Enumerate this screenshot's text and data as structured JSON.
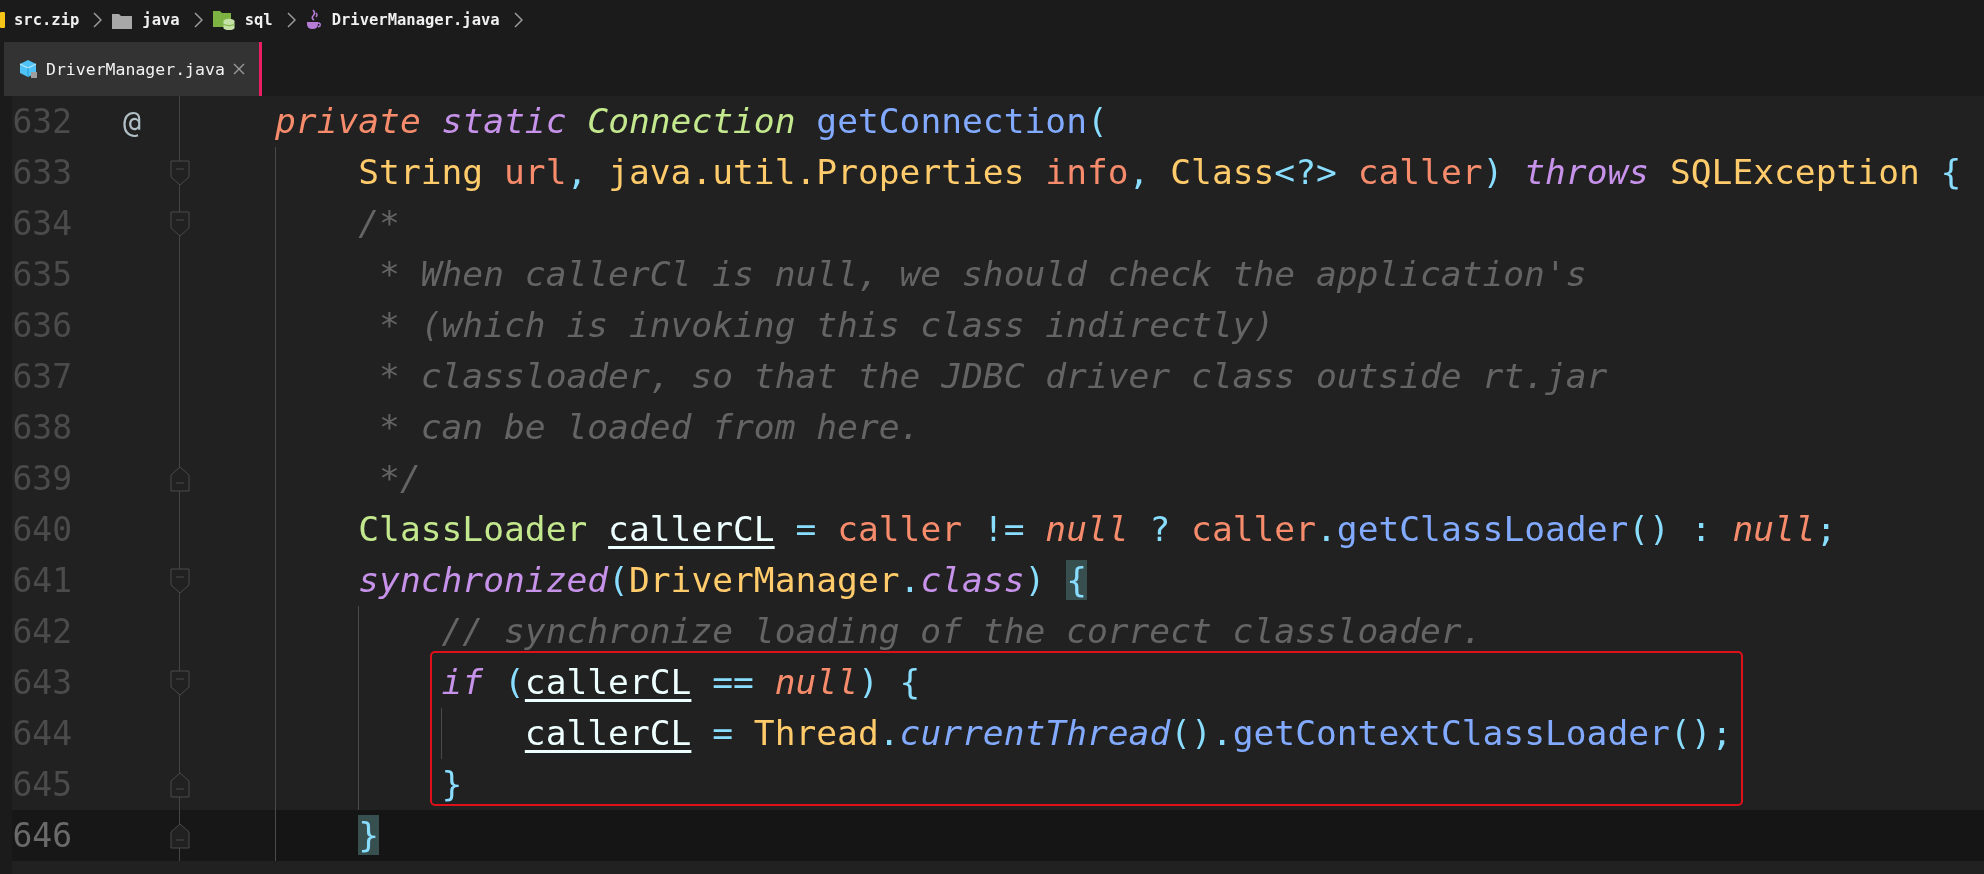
{
  "breadcrumb": [
    {
      "label": "src.zip",
      "kind": "archive"
    },
    {
      "label": "java",
      "kind": "folder"
    },
    {
      "label": "sql",
      "kind": "package"
    },
    {
      "label": "DriverManager.java",
      "kind": "java"
    }
  ],
  "tabs": [
    {
      "label": "DriverManager.java",
      "selected": true
    }
  ],
  "editor": {
    "lines": [
      {
        "number": "632",
        "marker": "@",
        "fold_start": false,
        "fold_end": false,
        "boxed": false,
        "current": false,
        "tokens": [
          {
            "text": "private",
            "kind": "modifier"
          },
          {
            "text": " static",
            "kind": "keyword"
          },
          {
            "text": " Connection",
            "kind": "classname-italic"
          },
          {
            "text": " getConnection",
            "kind": "function"
          },
          {
            "text": "(",
            "kind": "punct"
          }
        ]
      },
      {
        "number": "633",
        "fold_start": true,
        "fold_end": false,
        "boxed": false,
        "current": false,
        "tokens": [
          {
            "text": "    String",
            "kind": "type"
          },
          {
            "text": " url",
            "kind": "param"
          },
          {
            "text": ", ",
            "kind": "punct"
          },
          {
            "text": "java.util.Properties",
            "kind": "type"
          },
          {
            "text": " info",
            "kind": "param"
          },
          {
            "text": ", ",
            "kind": "punct"
          },
          {
            "text": "Class",
            "kind": "type"
          },
          {
            "text": "<?>",
            "kind": "punct"
          },
          {
            "text": " caller",
            "kind": "param"
          },
          {
            "text": ") ",
            "kind": "punct"
          },
          {
            "text": "throws",
            "kind": "keyword"
          },
          {
            "text": " SQLException",
            "kind": "type"
          },
          {
            "text": " {",
            "kind": "punct"
          }
        ]
      },
      {
        "number": "634",
        "fold_start": true,
        "fold_end": false,
        "boxed": false,
        "current": false,
        "tokens": [
          {
            "text": "    /*",
            "kind": "comment"
          }
        ]
      },
      {
        "number": "635",
        "fold_start": false,
        "fold_end": false,
        "boxed": false,
        "current": false,
        "tokens": [
          {
            "text": "     * When callerCl is null, we should check the application's",
            "kind": "comment"
          }
        ]
      },
      {
        "number": "636",
        "fold_start": false,
        "fold_end": false,
        "boxed": false,
        "current": false,
        "tokens": [
          {
            "text": "     * (which is invoking this class indirectly)",
            "kind": "comment"
          }
        ]
      },
      {
        "number": "637",
        "fold_start": false,
        "fold_end": false,
        "boxed": false,
        "current": false,
        "tokens": [
          {
            "text": "     * classloader, so that the JDBC driver class outside rt.jar",
            "kind": "comment"
          }
        ]
      },
      {
        "number": "638",
        "fold_start": false,
        "fold_end": false,
        "boxed": false,
        "current": false,
        "tokens": [
          {
            "text": "     * can be loaded from here.",
            "kind": "comment"
          }
        ]
      },
      {
        "number": "639",
        "fold_start": false,
        "fold_end": true,
        "boxed": false,
        "current": false,
        "tokens": [
          {
            "text": "     */",
            "kind": "comment"
          }
        ]
      },
      {
        "number": "640",
        "fold_start": false,
        "fold_end": false,
        "boxed": false,
        "current": false,
        "tokens": [
          {
            "text": "    ClassLoader",
            "kind": "classname"
          },
          {
            "text": " callerCL",
            "kind": "variable"
          },
          {
            "text": " = ",
            "kind": "punct"
          },
          {
            "text": "caller",
            "kind": "param"
          },
          {
            "text": " != ",
            "kind": "punct"
          },
          {
            "text": "null",
            "kind": "modifier"
          },
          {
            "text": " ? ",
            "kind": "punct"
          },
          {
            "text": "caller",
            "kind": "param"
          },
          {
            "text": ".",
            "kind": "punct"
          },
          {
            "text": "getClassLoader",
            "kind": "function"
          },
          {
            "text": "() : ",
            "kind": "punct"
          },
          {
            "text": "null",
            "kind": "modifier"
          },
          {
            "text": ";",
            "kind": "punct"
          }
        ]
      },
      {
        "number": "641",
        "fold_start": true,
        "fold_end": false,
        "boxed": false,
        "current": false,
        "tokens": [
          {
            "text": "    synchronized",
            "kind": "keyword"
          },
          {
            "text": "(",
            "kind": "punct"
          },
          {
            "text": "DriverManager",
            "kind": "type"
          },
          {
            "text": ".",
            "kind": "punct"
          },
          {
            "text": "class",
            "kind": "keyword"
          },
          {
            "text": ") ",
            "kind": "punct"
          },
          {
            "text": "{",
            "kind": "brace-match"
          }
        ]
      },
      {
        "number": "642",
        "fold_start": false,
        "fold_end": false,
        "boxed": false,
        "current": false,
        "tokens": [
          {
            "text": "        // synchronize loading of the correct classloader.",
            "kind": "comment"
          }
        ]
      },
      {
        "number": "643",
        "fold_start": true,
        "fold_end": false,
        "boxed": true,
        "current": false,
        "tokens": [
          {
            "text": "        if",
            "kind": "keyword"
          },
          {
            "text": " (",
            "kind": "punct"
          },
          {
            "text": "callerCL",
            "kind": "variable"
          },
          {
            "text": " == ",
            "kind": "punct"
          },
          {
            "text": "null",
            "kind": "modifier"
          },
          {
            "text": ") {",
            "kind": "punct"
          }
        ]
      },
      {
        "number": "644",
        "fold_start": false,
        "fold_end": false,
        "boxed": true,
        "current": false,
        "tokens": [
          {
            "text": "            callerCL",
            "kind": "variable"
          },
          {
            "text": " = ",
            "kind": "punct"
          },
          {
            "text": "Thread",
            "kind": "type"
          },
          {
            "text": ".",
            "kind": "punct"
          },
          {
            "text": "currentThread",
            "kind": "function-italic"
          },
          {
            "text": "().",
            "kind": "punct"
          },
          {
            "text": "getContextClassLoader",
            "kind": "function"
          },
          {
            "text": "();",
            "kind": "punct"
          }
        ]
      },
      {
        "number": "645",
        "fold_start": false,
        "fold_end": true,
        "boxed": true,
        "current": false,
        "tokens": [
          {
            "text": "        }",
            "kind": "punct"
          }
        ]
      },
      {
        "number": "646",
        "fold_start": false,
        "fold_end": true,
        "boxed": false,
        "current": true,
        "tokens": [
          {
            "text": "    }",
            "kind": "brace-match"
          }
        ]
      }
    ]
  }
}
